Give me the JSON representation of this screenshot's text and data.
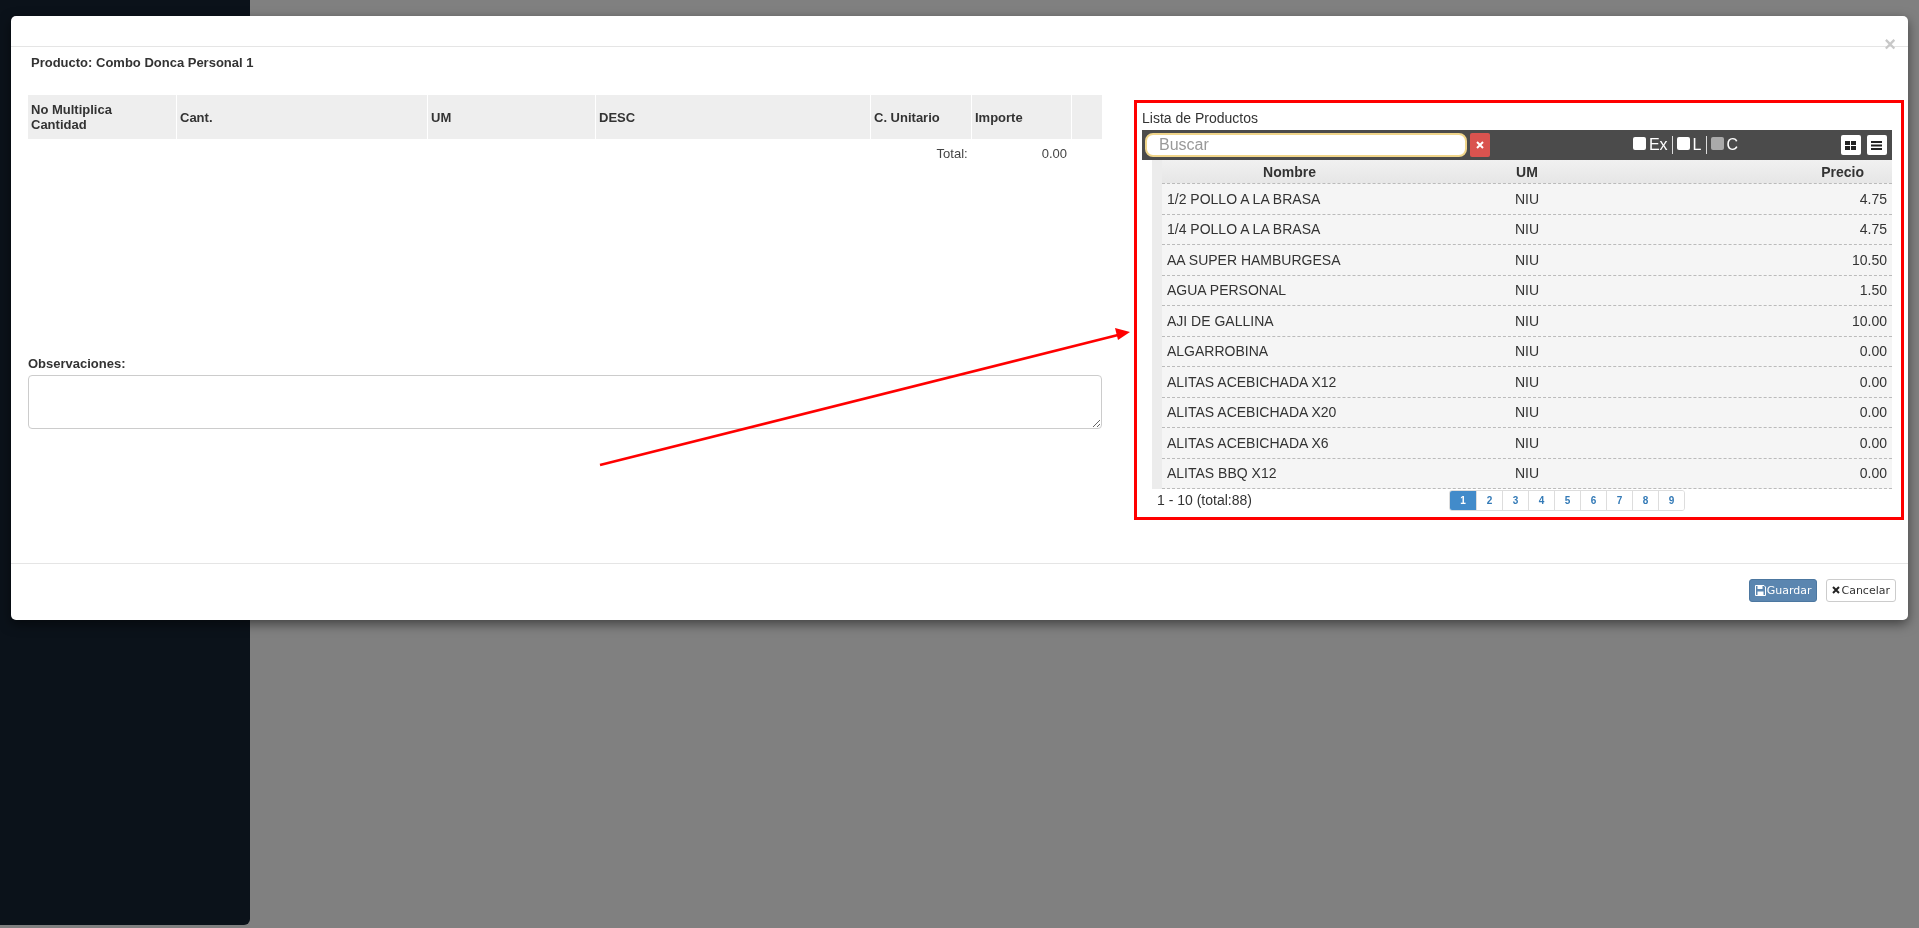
{
  "modal": {
    "title": "Producto: Combo Donca Personal 1",
    "close_icon": "×"
  },
  "components_table": {
    "columns": [
      "No Multiplica Cantidad",
      "Cant.",
      "UM",
      "DESC",
      "C. Unitario",
      "Importe"
    ],
    "total_label": "Total:",
    "total_value": "0.00"
  },
  "observations": {
    "label": "Observaciones:"
  },
  "product_list": {
    "title": "Lista de Productos",
    "search": {
      "placeholder": "Buscar"
    },
    "filters": [
      {
        "label": "Ex",
        "checked": false,
        "disabled": false
      },
      {
        "label": "L",
        "checked": false,
        "disabled": false
      },
      {
        "label": "C",
        "checked": false,
        "disabled": true
      }
    ],
    "views": [
      {
        "kind": "grid"
      },
      {
        "kind": "list"
      }
    ],
    "columns": [
      "Nombre",
      "UM",
      "Precio"
    ],
    "rows": [
      {
        "name": "1/2 POLLO A LA BRASA",
        "um": "NIU",
        "price": "4.75"
      },
      {
        "name": "1/4 POLLO A LA BRASA",
        "um": "NIU",
        "price": "4.75"
      },
      {
        "name": "AA SUPER HAMBURGESA",
        "um": "NIU",
        "price": "10.50"
      },
      {
        "name": "AGUA PERSONAL",
        "um": "NIU",
        "price": "1.50"
      },
      {
        "name": "AJI DE GALLINA",
        "um": "NIU",
        "price": "10.00"
      },
      {
        "name": "ALGARROBINA",
        "um": "NIU",
        "price": "0.00"
      },
      {
        "name": "ALITAS ACEBICHADA X12",
        "um": "NIU",
        "price": "0.00"
      },
      {
        "name": "ALITAS ACEBICHADA X20",
        "um": "NIU",
        "price": "0.00"
      },
      {
        "name": "ALITAS ACEBICHADA X6",
        "um": "NIU",
        "price": "0.00"
      },
      {
        "name": "ALITAS BBQ X12",
        "um": "NIU",
        "price": "0.00"
      }
    ],
    "range": "1 - 10 (total:88)",
    "pages": [
      {
        "label": "1",
        "selected": true
      },
      {
        "label": "2",
        "selected": false
      },
      {
        "label": "3",
        "selected": false
      },
      {
        "label": "4",
        "selected": false
      },
      {
        "label": "5",
        "selected": false
      },
      {
        "label": "6",
        "selected": false
      },
      {
        "label": "7",
        "selected": false
      },
      {
        "label": "8",
        "selected": false
      },
      {
        "label": "9",
        "selected": false
      }
    ]
  },
  "buttons": [
    {
      "kind": "save",
      "label": "Guardar"
    },
    {
      "kind": "cancel",
      "label": "Cancelar"
    }
  ]
}
